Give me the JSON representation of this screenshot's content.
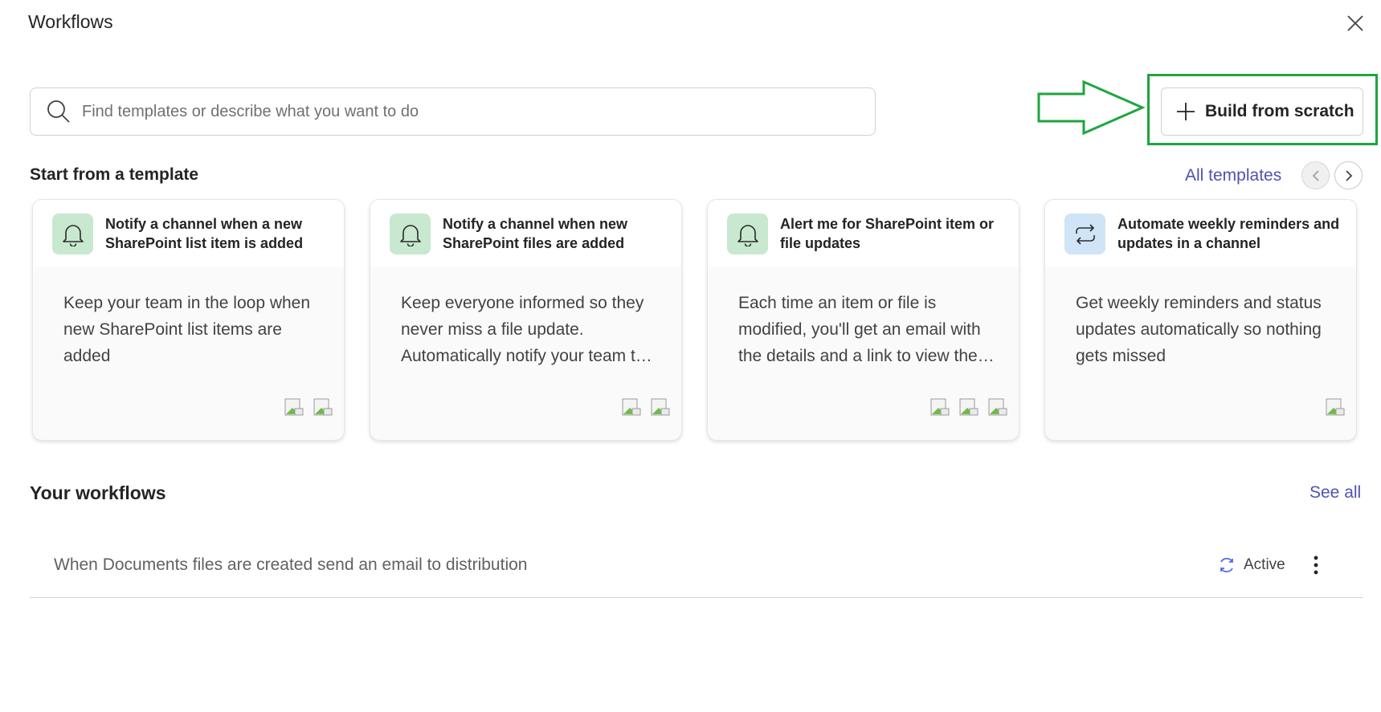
{
  "header": {
    "title": "Workflows"
  },
  "search": {
    "placeholder": "Find templates or describe what you want to do"
  },
  "build": {
    "label": "Build from scratch"
  },
  "templates": {
    "section_title": "Start from a template",
    "all_label": "All templates",
    "cards": [
      {
        "title": "Notify a channel when a new SharePoint list item is added",
        "description": "Keep your team in the loop when new SharePoint list items are added",
        "icon": "bell-icon",
        "icon_color": "#c8e8cf",
        "connectors": 2
      },
      {
        "title": "Notify a channel when new SharePoint files are added",
        "description": "Keep everyone informed so they never miss a file update. Automatically notify your team t…",
        "icon": "bell-icon",
        "icon_color": "#c8e8cf",
        "connectors": 2
      },
      {
        "title": "Alert me for SharePoint item or file updates",
        "description": "Each time an item or file is modified, you'll get an email with the details and a link to view the…",
        "icon": "bell-icon",
        "icon_color": "#c8e8cf",
        "connectors": 3
      },
      {
        "title": "Automate weekly reminders and updates in a channel",
        "description": "Get weekly reminders and status updates automatically so nothing gets missed",
        "icon": "repeat-icon",
        "icon_color": "#cfe4f6",
        "connectors": 1
      }
    ]
  },
  "workflows": {
    "section_title": "Your workflows",
    "see_all_label": "See all",
    "items": [
      {
        "name": "When Documents files are created send an email to distribution",
        "status": "Active"
      }
    ]
  },
  "colors": {
    "accent": "#4f52b2",
    "highlight": "#1ea53e"
  }
}
